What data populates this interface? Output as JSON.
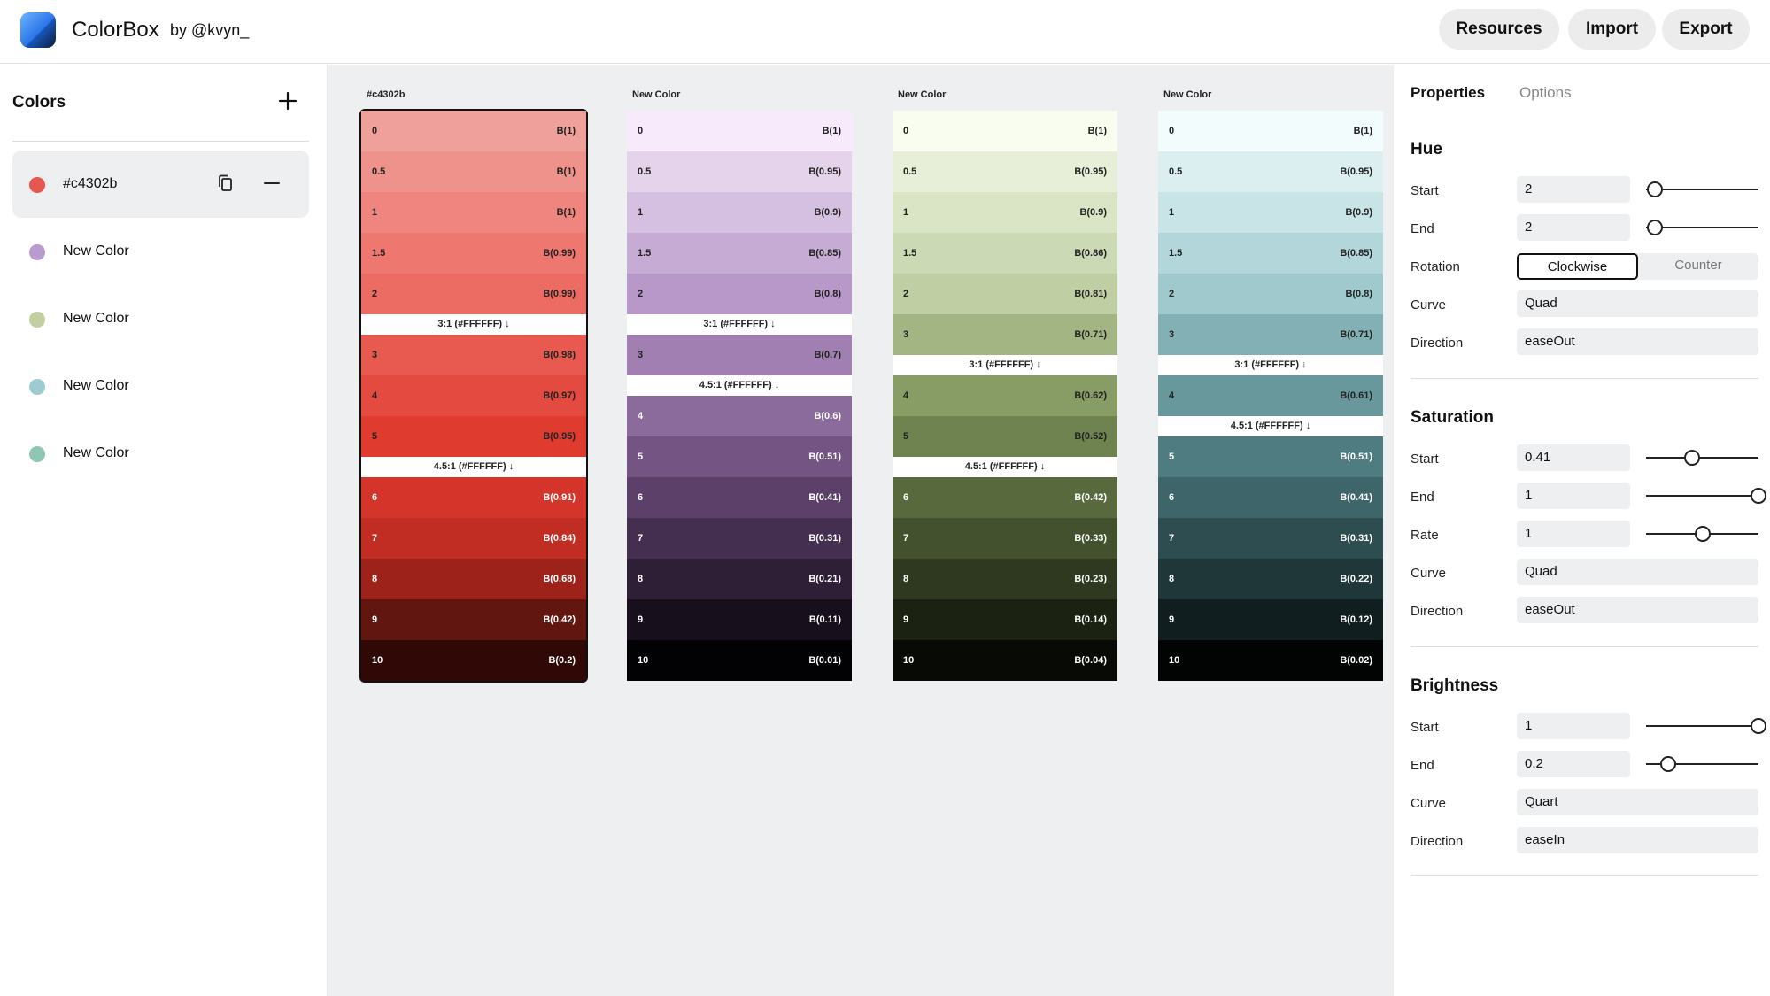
{
  "header": {
    "app_name": "ColorBox",
    "author": "by @kvyn_",
    "buttons": {
      "resources": "Resources",
      "import": "Import",
      "export": "Export"
    }
  },
  "sidebar": {
    "title": "Colors",
    "items": [
      {
        "label": "#c4302b",
        "color": "#e5574f",
        "active": true
      },
      {
        "label": "New Color",
        "color": "#b99bd0",
        "active": false
      },
      {
        "label": "New Color",
        "color": "#c2cf9e",
        "active": false
      },
      {
        "label": "New Color",
        "color": "#9ccbd1",
        "active": false
      },
      {
        "label": "New Color",
        "color": "#8fc6b5",
        "active": false
      }
    ]
  },
  "palettes": [
    {
      "title": "#c4302b",
      "selected": true,
      "rows": [
        {
          "type": "swatch",
          "step": "0",
          "value": "B(1)",
          "bg": "#f0a09a",
          "fg": "#222"
        },
        {
          "type": "swatch",
          "step": "0.5",
          "value": "B(1)",
          "bg": "#ef928b",
          "fg": "#222"
        },
        {
          "type": "swatch",
          "step": "1",
          "value": "B(1)",
          "bg": "#ef857e",
          "fg": "#222"
        },
        {
          "type": "swatch",
          "step": "1.5",
          "value": "B(0.99)",
          "bg": "#ee776f",
          "fg": "#222"
        },
        {
          "type": "swatch",
          "step": "2",
          "value": "B(0.99)",
          "bg": "#ec6c63",
          "fg": "#222"
        },
        {
          "type": "contrast",
          "label": "3:1 (#FFFFFF) ↓"
        },
        {
          "type": "swatch",
          "step": "3",
          "value": "B(0.98)",
          "bg": "#e85a50",
          "fg": "#222"
        },
        {
          "type": "swatch",
          "step": "4",
          "value": "B(0.97)",
          "bg": "#e44a3f",
          "fg": "#222"
        },
        {
          "type": "swatch",
          "step": "5",
          "value": "B(0.95)",
          "bg": "#df3b2f",
          "fg": "#222"
        },
        {
          "type": "contrast",
          "label": "4.5:1 (#FFFFFF) ↓"
        },
        {
          "type": "swatch",
          "step": "6",
          "value": "B(0.91)",
          "bg": "#d43429",
          "fg": "#fff"
        },
        {
          "type": "swatch",
          "step": "7",
          "value": "B(0.84)",
          "bg": "#c22d23",
          "fg": "#fff"
        },
        {
          "type": "swatch",
          "step": "8",
          "value": "B(0.68)",
          "bg": "#9c221a",
          "fg": "#fff"
        },
        {
          "type": "swatch",
          "step": "9",
          "value": "B(0.42)",
          "bg": "#621610",
          "fg": "#fff"
        },
        {
          "type": "swatch",
          "step": "10",
          "value": "B(0.2)",
          "bg": "#300805",
          "fg": "#fff"
        }
      ]
    },
    {
      "title": "New Color",
      "selected": false,
      "rows": [
        {
          "type": "swatch",
          "step": "0",
          "value": "B(1)",
          "bg": "#f6eafb",
          "fg": "#222"
        },
        {
          "type": "swatch",
          "step": "0.5",
          "value": "B(0.95)",
          "bg": "#e5d3ec",
          "fg": "#222"
        },
        {
          "type": "swatch",
          "step": "1",
          "value": "B(0.9)",
          "bg": "#d6c0e1",
          "fg": "#222"
        },
        {
          "type": "swatch",
          "step": "1.5",
          "value": "B(0.85)",
          "bg": "#c6abd4",
          "fg": "#222"
        },
        {
          "type": "swatch",
          "step": "2",
          "value": "B(0.8)",
          "bg": "#b898c8",
          "fg": "#222"
        },
        {
          "type": "contrast",
          "label": "3:1 (#FFFFFF) ↓"
        },
        {
          "type": "swatch",
          "step": "3",
          "value": "B(0.7)",
          "bg": "#a17fb2",
          "fg": "#222"
        },
        {
          "type": "contrast",
          "label": "4.5:1 (#FFFFFF) ↓"
        },
        {
          "type": "swatch",
          "step": "4",
          "value": "B(0.6)",
          "bg": "#8b6a9c",
          "fg": "#fff"
        },
        {
          "type": "swatch",
          "step": "5",
          "value": "B(0.51)",
          "bg": "#735483",
          "fg": "#fff"
        },
        {
          "type": "swatch",
          "step": "6",
          "value": "B(0.41)",
          "bg": "#5c4069",
          "fg": "#fff"
        },
        {
          "type": "swatch",
          "step": "7",
          "value": "B(0.31)",
          "bg": "#452f50",
          "fg": "#fff"
        },
        {
          "type": "swatch",
          "step": "8",
          "value": "B(0.21)",
          "bg": "#2e1e36",
          "fg": "#fff"
        },
        {
          "type": "swatch",
          "step": "9",
          "value": "B(0.11)",
          "bg": "#170f1c",
          "fg": "#fff"
        },
        {
          "type": "swatch",
          "step": "10",
          "value": "B(0.01)",
          "bg": "#020103",
          "fg": "#fff"
        }
      ]
    },
    {
      "title": "New Color",
      "selected": false,
      "rows": [
        {
          "type": "swatch",
          "step": "0",
          "value": "B(1)",
          "bg": "#f9fdef",
          "fg": "#222"
        },
        {
          "type": "swatch",
          "step": "0.5",
          "value": "B(0.95)",
          "bg": "#e7efd8",
          "fg": "#222"
        },
        {
          "type": "swatch",
          "step": "1",
          "value": "B(0.9)",
          "bg": "#dae5c6",
          "fg": "#222"
        },
        {
          "type": "swatch",
          "step": "1.5",
          "value": "B(0.86)",
          "bg": "#ccd9b5",
          "fg": "#222"
        },
        {
          "type": "swatch",
          "step": "2",
          "value": "B(0.81)",
          "bg": "#bfcfa3",
          "fg": "#222"
        },
        {
          "type": "swatch",
          "step": "3",
          "value": "B(0.71)",
          "bg": "#a3b583",
          "fg": "#222"
        },
        {
          "type": "contrast",
          "label": "3:1 (#FFFFFF) ↓"
        },
        {
          "type": "swatch",
          "step": "4",
          "value": "B(0.62)",
          "bg": "#889c66",
          "fg": "#222"
        },
        {
          "type": "swatch",
          "step": "5",
          "value": "B(0.52)",
          "bg": "#6f8350",
          "fg": "#222"
        },
        {
          "type": "contrast",
          "label": "4.5:1 (#FFFFFF) ↓"
        },
        {
          "type": "swatch",
          "step": "6",
          "value": "B(0.42)",
          "bg": "#58693e",
          "fg": "#fff"
        },
        {
          "type": "swatch",
          "step": "7",
          "value": "B(0.33)",
          "bg": "#43512e",
          "fg": "#fff"
        },
        {
          "type": "swatch",
          "step": "8",
          "value": "B(0.23)",
          "bg": "#2e391f",
          "fg": "#fff"
        },
        {
          "type": "swatch",
          "step": "9",
          "value": "B(0.14)",
          "bg": "#1b2212",
          "fg": "#fff"
        },
        {
          "type": "swatch",
          "step": "10",
          "value": "B(0.04)",
          "bg": "#080a05",
          "fg": "#fff"
        }
      ]
    },
    {
      "title": "New Color",
      "selected": false,
      "rows": [
        {
          "type": "swatch",
          "step": "0",
          "value": "B(1)",
          "bg": "#f2fcfd",
          "fg": "#222"
        },
        {
          "type": "swatch",
          "step": "0.5",
          "value": "B(0.95)",
          "bg": "#dbeef0",
          "fg": "#222"
        },
        {
          "type": "swatch",
          "step": "1",
          "value": "B(0.9)",
          "bg": "#c8e4e7",
          "fg": "#222"
        },
        {
          "type": "swatch",
          "step": "1.5",
          "value": "B(0.85)",
          "bg": "#b3d6da",
          "fg": "#222"
        },
        {
          "type": "swatch",
          "step": "2",
          "value": "B(0.8)",
          "bg": "#9fc9cd",
          "fg": "#222"
        },
        {
          "type": "swatch",
          "step": "3",
          "value": "B(0.71)",
          "bg": "#82b0b4",
          "fg": "#222"
        },
        {
          "type": "contrast",
          "label": "3:1 (#FFFFFF) ↓"
        },
        {
          "type": "swatch",
          "step": "4",
          "value": "B(0.61)",
          "bg": "#69989c",
          "fg": "#222"
        },
        {
          "type": "contrast",
          "label": "4.5:1 (#FFFFFF) ↓"
        },
        {
          "type": "swatch",
          "step": "5",
          "value": "B(0.51)",
          "bg": "#4f7c81",
          "fg": "#fff"
        },
        {
          "type": "swatch",
          "step": "6",
          "value": "B(0.41)",
          "bg": "#3e6569",
          "fg": "#fff"
        },
        {
          "type": "swatch",
          "step": "7",
          "value": "B(0.31)",
          "bg": "#2d4d50",
          "fg": "#fff"
        },
        {
          "type": "swatch",
          "step": "8",
          "value": "B(0.22)",
          "bg": "#1f3739",
          "fg": "#fff"
        },
        {
          "type": "swatch",
          "step": "9",
          "value": "B(0.12)",
          "bg": "#101e1f",
          "fg": "#fff"
        },
        {
          "type": "swatch",
          "step": "10",
          "value": "B(0.02)",
          "bg": "#020404",
          "fg": "#fff"
        }
      ]
    }
  ],
  "zoom": {
    "zoom_in_icon": "plus-icon",
    "reset_icon": "target-icon",
    "zoom_out_icon": "minus-icon"
  },
  "properties": {
    "tabs": {
      "properties": "Properties",
      "options": "Options"
    },
    "hue": {
      "title": "Hue",
      "start_label": "Start",
      "start_value": "2",
      "start_fraction": 0.08,
      "end_label": "End",
      "end_value": "2",
      "end_fraction": 0.08,
      "rotation_label": "Rotation",
      "rotation_on": "Clockwise",
      "rotation_off": "Counter",
      "curve_label": "Curve",
      "curve_value": "Quad",
      "direction_label": "Direction",
      "direction_value": "easeOut"
    },
    "saturation": {
      "title": "Saturation",
      "start_label": "Start",
      "start_value": "0.41",
      "start_fraction": 0.41,
      "end_label": "End",
      "end_value": "1",
      "end_fraction": 1.0,
      "rate_label": "Rate",
      "rate_value": "1",
      "rate_fraction": 0.5,
      "curve_label": "Curve",
      "curve_value": "Quad",
      "direction_label": "Direction",
      "direction_value": "easeOut"
    },
    "brightness": {
      "title": "Brightness",
      "start_label": "Start",
      "start_value": "1",
      "start_fraction": 1.0,
      "end_label": "End",
      "end_value": "0.2",
      "end_fraction": 0.2,
      "curve_label": "Curve",
      "curve_value": "Quart",
      "direction_label": "Direction",
      "direction_value": "easeIn"
    }
  }
}
